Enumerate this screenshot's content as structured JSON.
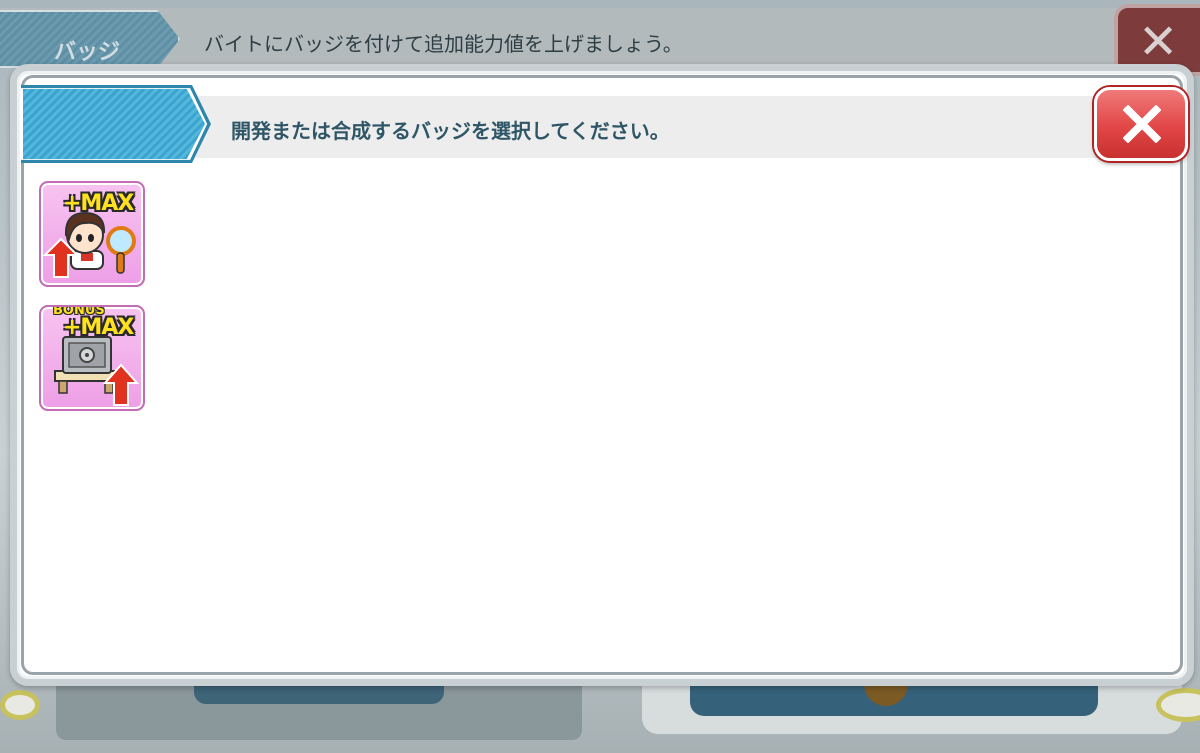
{
  "background": {
    "tab_label": "バッジ",
    "instruction": "バイトにバッジを付けて追加能力値を上げましょう。"
  },
  "dialog": {
    "title": "開発または合成するバッジを選択してください。",
    "close_icon": "close-x-icon"
  },
  "badges": [
    {
      "tag": "+MAX",
      "icon": "character-mirror-upgrade-badge"
    },
    {
      "tag": "+MAX",
      "bonus_label": "BONUS",
      "icon": "safe-upgrade-badge"
    }
  ],
  "colors": {
    "tab_blue": "#3aa3cf",
    "close_red": "#e24646",
    "badge_pink": "#ee9fe6",
    "max_yellow": "#ffe11f",
    "arrow_red": "#e0321e"
  }
}
